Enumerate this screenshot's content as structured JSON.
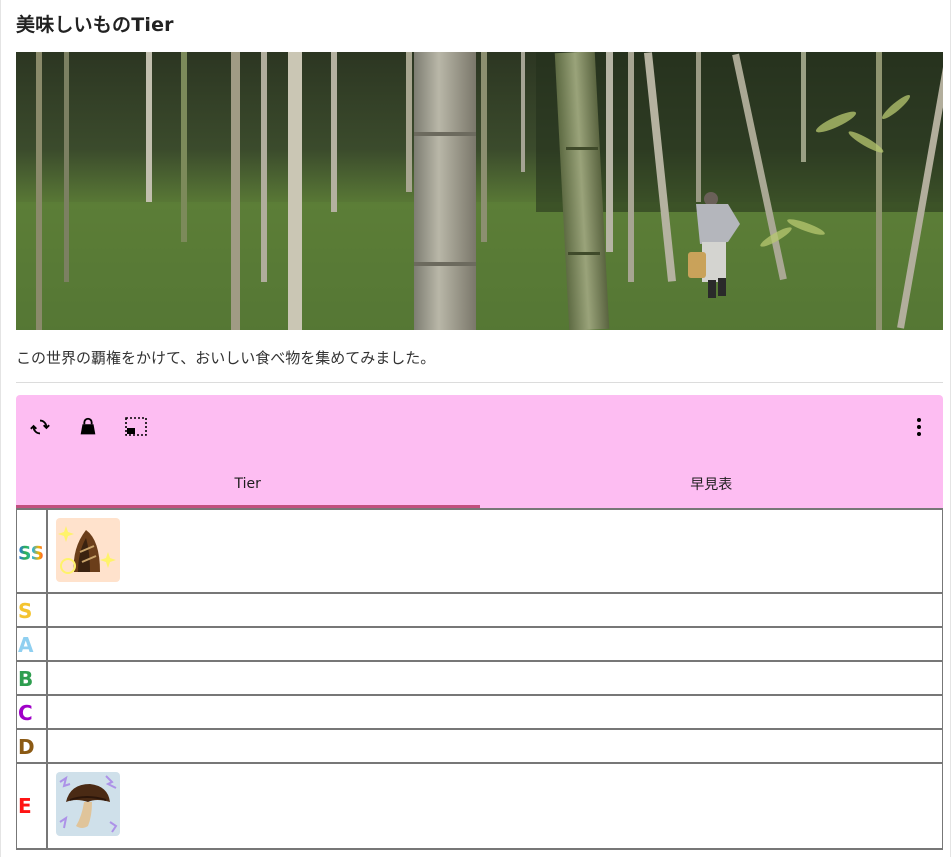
{
  "page": {
    "title": "美味しいものTier",
    "description": "この世界の覇権をかけて、おいしい食べ物を集めてみました。"
  },
  "toolbar": {
    "icons": [
      "refresh-icon",
      "bag-icon",
      "picture-in-picture-icon",
      "more-vert-icon"
    ],
    "background": "#fdbdf2"
  },
  "tabs": [
    {
      "label": "Tier",
      "active": true
    },
    {
      "label": "早見表",
      "active": false
    }
  ],
  "tiers": [
    {
      "label": "SS",
      "items": [
        "takenoko"
      ]
    },
    {
      "label": "S",
      "items": []
    },
    {
      "label": "A",
      "items": []
    },
    {
      "label": "B",
      "items": []
    },
    {
      "label": "C",
      "items": []
    },
    {
      "label": "D",
      "items": []
    },
    {
      "label": "E",
      "items": [
        "mushroom"
      ]
    }
  ],
  "colors": {
    "tab_indicator": "#c24f7f",
    "S": "#f4c430",
    "A": "#8fcff0",
    "B": "#2e9e4f",
    "C": "#a000c8",
    "D": "#8b5a14",
    "E": "#ff1414"
  }
}
